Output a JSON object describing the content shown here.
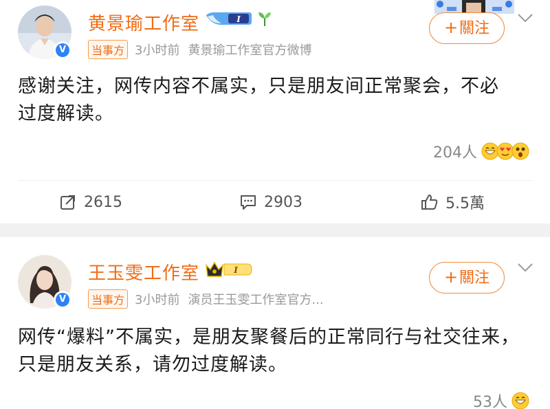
{
  "posts": [
    {
      "author": "黄景瑜工作室",
      "tag": "当事方",
      "time": "3小时前",
      "source": "黄景瑜工作室官方微博",
      "follow_label": "關注",
      "follow_plus": "+",
      "content_line1": "感谢关注，网传内容不属实，只是朋友间正常聚会，不必",
      "content_line2": "过度解读。",
      "reactions": "204人",
      "reposts": "2615",
      "comments": "2903",
      "likes": "5.5萬"
    },
    {
      "author": "王玉雯工作室",
      "tag": "当事方",
      "time": "3小时前",
      "source": "演员王玉雯工作室官方...",
      "follow_label": "關注",
      "follow_plus": "+",
      "content_line1": "网传“爆料”不属实，是朋友聚餐后的正常同行与社交往来，",
      "content_line2": "只是朋友关系，请勿过度解读。",
      "reactions": "53人"
    }
  ],
  "badges": {
    "verified": "V",
    "rank_level": "I"
  },
  "icons": {
    "repost": "repost-icon",
    "comment": "comment-icon",
    "like": "thumbs-up-icon",
    "more": "chevron-down-icon"
  },
  "colors": {
    "accent": "#f16b14",
    "verified": "#2f82f5",
    "meta": "#999999",
    "separator": "#f1f1f1"
  }
}
